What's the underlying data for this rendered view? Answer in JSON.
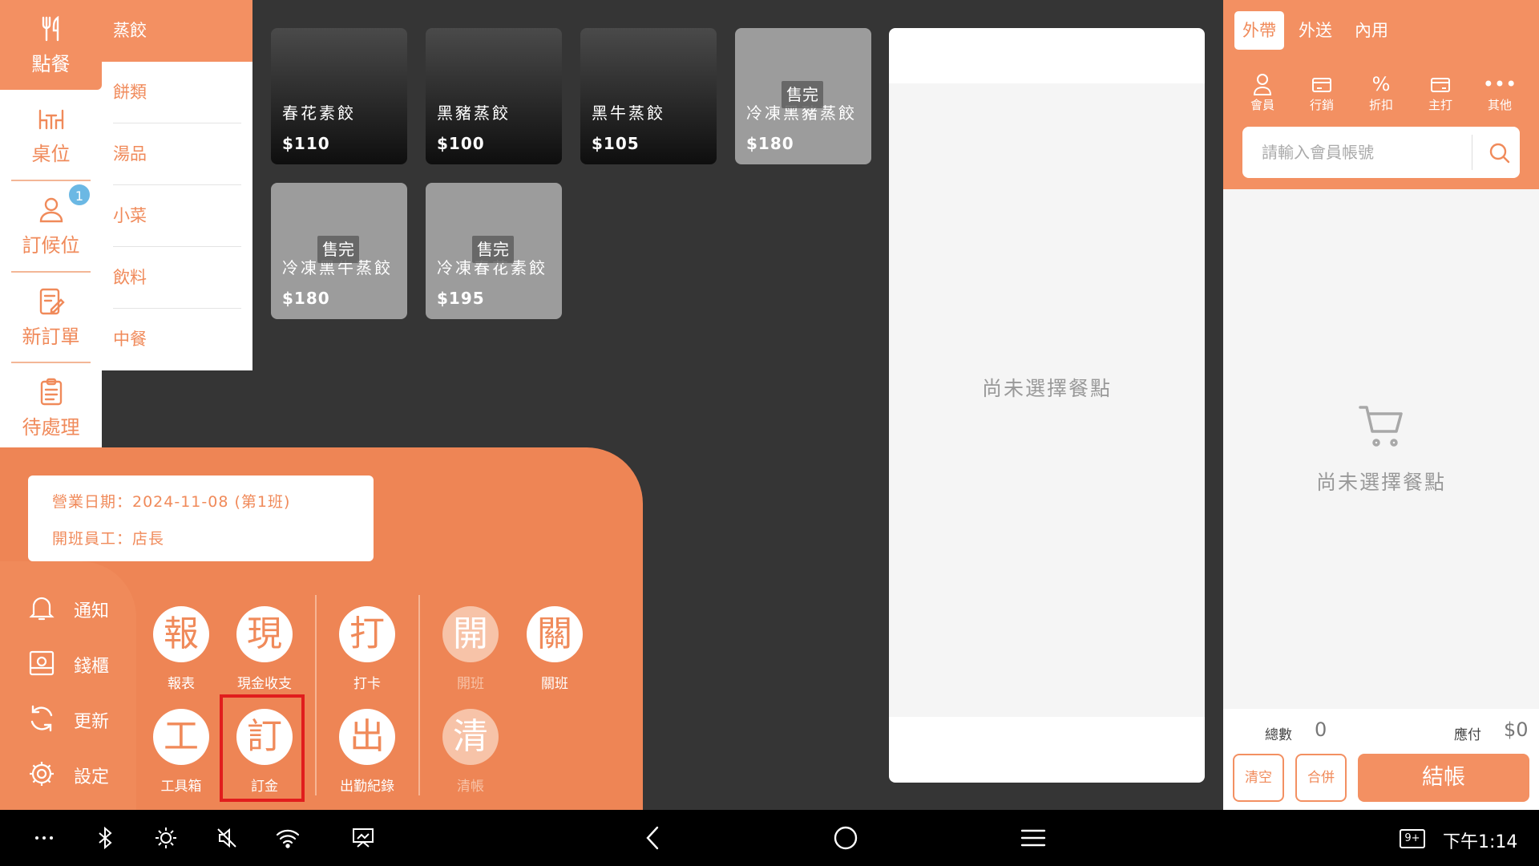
{
  "nav": {
    "items": [
      {
        "label": "點餐",
        "icon": "utensils-icon",
        "active": true
      },
      {
        "label": "桌位",
        "icon": "table-icon"
      },
      {
        "label": "訂候位",
        "icon": "person-icon",
        "badge": "1"
      },
      {
        "label": "新訂單",
        "icon": "edit-order-icon"
      },
      {
        "label": "待處理",
        "icon": "clipboard-icon"
      }
    ]
  },
  "categories": [
    "蒸餃",
    "餅類",
    "湯品",
    "小菜",
    "飲料",
    "中餐"
  ],
  "products": [
    {
      "name": "春花素餃",
      "price": "$110",
      "sold_out": false
    },
    {
      "name": "黑豬蒸餃",
      "price": "$100",
      "sold_out": false
    },
    {
      "name": "黑牛蒸餃",
      "price": "$105",
      "sold_out": false
    },
    {
      "name": "冷凍黑豬蒸餃",
      "price": "$180",
      "sold_out": true,
      "tag": "售完"
    },
    {
      "name": "冷凍黑牛蒸餃",
      "price": "$180",
      "sold_out": true,
      "tag": "售完"
    },
    {
      "name": "冷凍春花素餃",
      "price": "$195",
      "sold_out": true,
      "tag": "售完"
    }
  ],
  "detail": {
    "empty_text": "尚未選擇餐點"
  },
  "order": {
    "tabs": [
      "外帶",
      "外送",
      "內用"
    ],
    "active_tab": "外帶",
    "tools": [
      {
        "label": "會員",
        "icon": "member-icon"
      },
      {
        "label": "行銷",
        "icon": "marketing-icon"
      },
      {
        "label": "折扣",
        "icon": "percent-icon"
      },
      {
        "label": "主打",
        "icon": "featured-icon"
      },
      {
        "label": "其他",
        "icon": "more-icon"
      }
    ],
    "member_placeholder": "請輸入會員帳號",
    "empty_text": "尚未選擇餐點",
    "total_count_label": "總數",
    "total_count": "0",
    "due_label": "應付",
    "due": "$0",
    "clear_label": "清空",
    "merge_label": "合併",
    "checkout_label": "結帳"
  },
  "shift": {
    "business_date": "營業日期：2024-11-08 (第1班)",
    "staff": "開班員工：店長"
  },
  "side_menu": [
    {
      "label": "通知",
      "icon": "bell-icon"
    },
    {
      "label": "錢櫃",
      "icon": "cash-drawer-icon"
    },
    {
      "label": "更新",
      "icon": "refresh-icon"
    },
    {
      "label": "設定",
      "icon": "gear-icon"
    }
  ],
  "functions": [
    {
      "char": "報",
      "label": "報表"
    },
    {
      "char": "現",
      "label": "現金收支"
    },
    {
      "char": "打",
      "label": "打卡"
    },
    {
      "char": "開",
      "label": "開班",
      "disabled": true
    },
    {
      "char": "關",
      "label": "關班"
    },
    {
      "char": "工",
      "label": "工具箱"
    },
    {
      "char": "訂",
      "label": "訂金"
    },
    {
      "char": "出",
      "label": "出勤紀錄"
    },
    {
      "char": "清",
      "label": "清帳",
      "disabled": true
    }
  ],
  "system": {
    "time": "下午1:14",
    "notif": "9+"
  },
  "colors": {
    "accent": "#f39062",
    "highlight": "#e11d1d",
    "badge": "#6bb8e4"
  }
}
